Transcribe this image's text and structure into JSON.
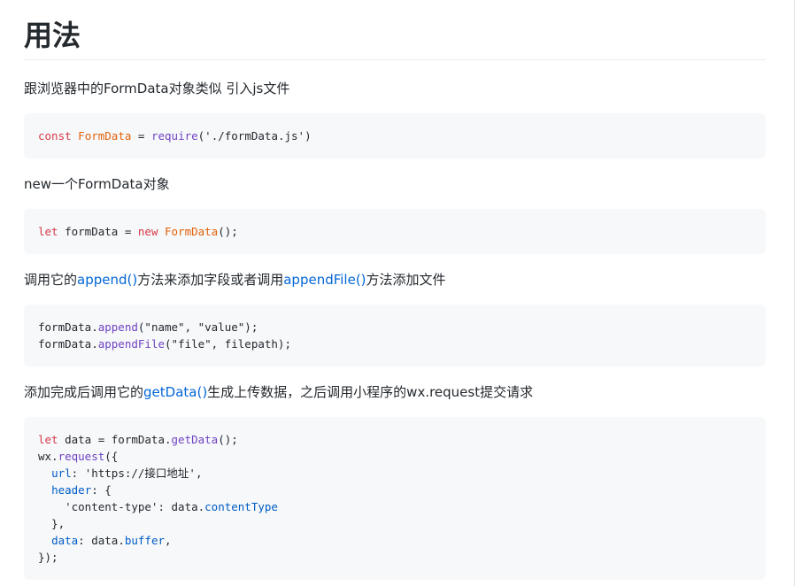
{
  "heading": "用法",
  "sections": [
    {
      "text_parts": [
        "跟浏览器中的FormData对象类似 引入js文件"
      ],
      "code": {
        "line1": {
          "kw": "const",
          "cls": "FormData",
          "op": " = ",
          "fn": "require",
          "rest": "('./formData.js')"
        }
      }
    },
    {
      "text_parts": [
        "new一个FormData对象"
      ],
      "code": {
        "line1": {
          "kw": "let",
          "var": " formData = ",
          "kw2": "new",
          "cls": "FormData",
          "rest": "();"
        }
      }
    },
    {
      "text_parts": [
        "调用它的",
        "append()",
        "方法来添加字段或者调用",
        "appendFile()",
        "方法添加文件"
      ],
      "code": {
        "line1": {
          "obj": "formData.",
          "fn": "append",
          "rest": "(\"name\", \"value\");"
        },
        "line2": {
          "obj": "formData.",
          "fn": "appendFile",
          "rest": "(\"file\", filepath);"
        }
      }
    },
    {
      "text_parts": [
        "添加完成后调用它的",
        "getData()",
        "生成上传数据，之后调用小程序的wx.request提交请求"
      ],
      "code": {
        "line1": {
          "kw": "let",
          "var": " data = formData.",
          "fn": "getData",
          "rest": "();"
        },
        "line2": {
          "obj": "wx.",
          "fn": "request",
          "rest": "({"
        },
        "line3": {
          "indent": "  ",
          "prop": "url",
          "rest": ": 'https://接口地址',"
        },
        "line4": {
          "indent": "  ",
          "prop": "header",
          "rest": ": {"
        },
        "line5": {
          "rest": "    'content-type': data.",
          "prop": "contentType"
        },
        "line6": {
          "rest": "  },"
        },
        "line7": {
          "indent": "  ",
          "prop": "data",
          "rest": ": data.",
          "prop2": "buffer",
          "tail": ","
        },
        "line8": {
          "rest": "});"
        }
      }
    }
  ]
}
